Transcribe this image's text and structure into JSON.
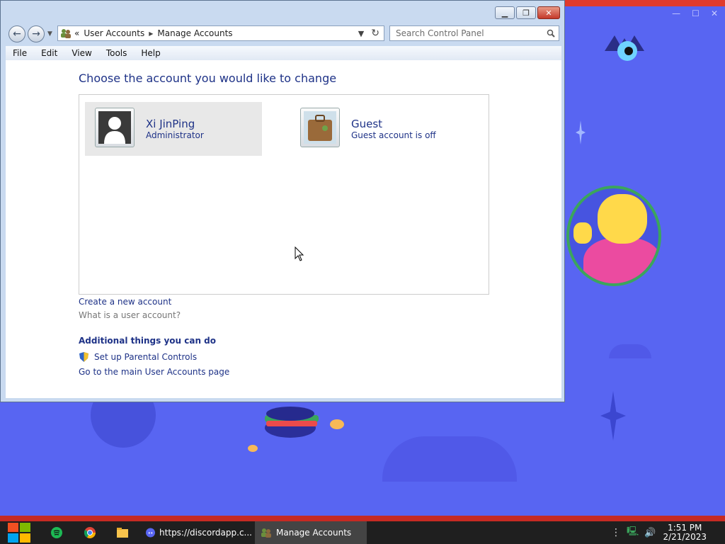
{
  "window": {
    "address_crumbs": [
      "User Accounts",
      "Manage Accounts"
    ],
    "address_prefix": "«",
    "search_placeholder": "Search Control Panel",
    "menu": [
      "File",
      "Edit",
      "View",
      "Tools",
      "Help"
    ]
  },
  "main": {
    "heading": "Choose the account you would like to change",
    "accounts": [
      {
        "name": "Xi JinPing",
        "subtitle": "Administrator",
        "selected": true
      },
      {
        "name": "Guest",
        "subtitle": "Guest account is off",
        "selected": false
      }
    ],
    "links": {
      "create": "Create a new account",
      "what_is": "What is a user account?"
    },
    "additional_heading": "Additional things you can do",
    "parental": "Set up Parental Controls",
    "main_page": "Go to the main User Accounts page"
  },
  "taskbar": {
    "tasks": [
      {
        "label": "https://discordapp.c..."
      },
      {
        "label": "Manage Accounts"
      }
    ],
    "time": "1:51 PM",
    "date": "2/21/2023"
  },
  "colors": {
    "desktop_bg": "#5865f2",
    "link_blue": "#1e3287",
    "taskbar": "#1f1f1f"
  }
}
